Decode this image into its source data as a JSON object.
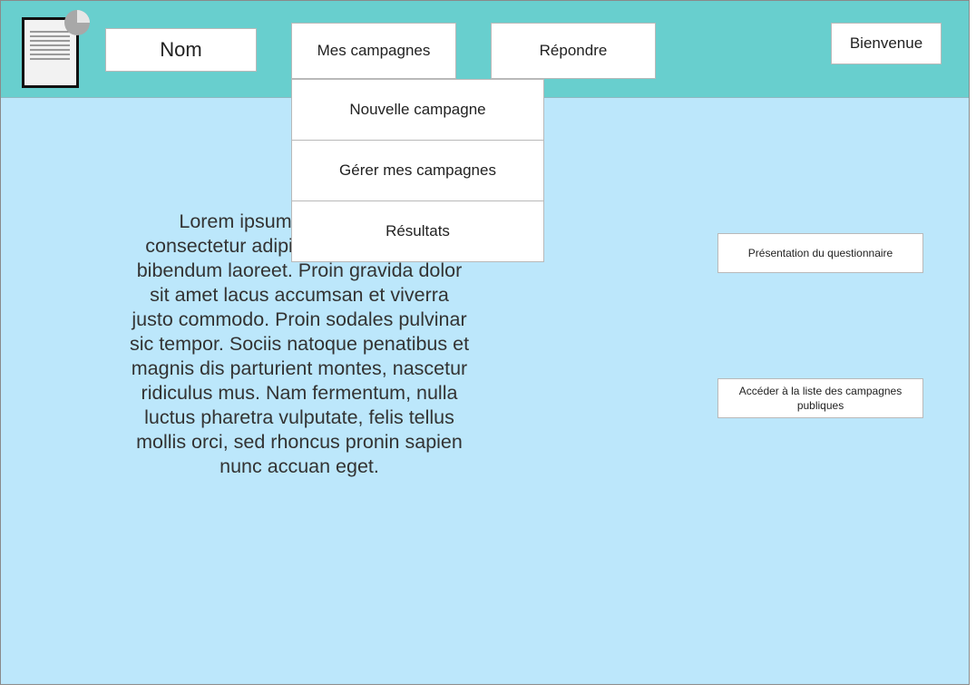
{
  "header": {
    "logo_icon": "document-chart-icon",
    "name_label": "Nom",
    "nav": {
      "mes_campagnes": "Mes campagnes",
      "repondre": "Répondre"
    },
    "welcome": "Bienvenue"
  },
  "dropdown": {
    "items": [
      {
        "label": "Nouvelle campagne"
      },
      {
        "label": "Gérer mes campagnes"
      },
      {
        "label": "Résultats"
      }
    ]
  },
  "main": {
    "lorem": "Lorem ipsum dolor sit amet, consectetur adipiscing elit, euismod bibendum laoreet. Proin gravida dolor sit amet lacus accumsan et viverra justo commodo. Proin sodales pulvinar sic tempor. Sociis natoque penatibus et magnis dis parturient montes, nascetur ridiculus mus. Nam fermentum, nulla luctus pharetra vulputate, felis tellus mollis orci, sed rhoncus pronin sapien nunc accuan eget.",
    "presentation_button": "Présentation du questionnaire",
    "access_list_button": "Accéder à la liste des campagnes publiques"
  },
  "colors": {
    "header_bg": "#68cfce",
    "body_bg": "#bce7fb"
  }
}
